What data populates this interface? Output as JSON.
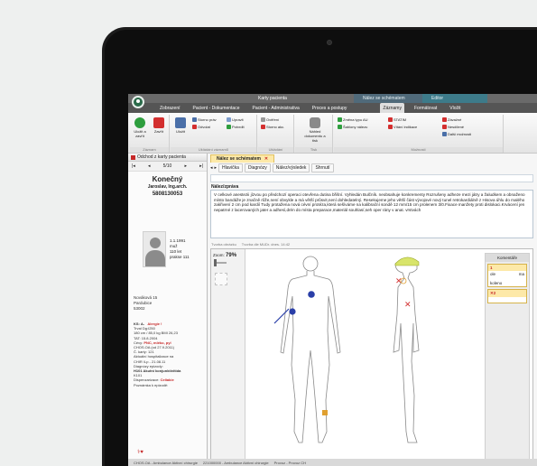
{
  "app": {
    "window_title": "Karty pacienta",
    "context_title_1": "Nález se schématem",
    "context_title_2": "Editor"
  },
  "tabs": [
    {
      "label": "Zobrazení"
    },
    {
      "label": "Pacient - Dokumentace"
    },
    {
      "label": "Pacient - Administrativa"
    },
    {
      "label": "Proces a postupy"
    },
    {
      "label": "Záznamy"
    },
    {
      "label": "Formátovat"
    },
    {
      "label": "Vložit"
    }
  ],
  "ribbon": {
    "btn_save": "Uložit a zavřít",
    "btn_close": "Zavřít",
    "btn_save2": "Uložit",
    "sm_1": "Storno práv",
    "sm_2": "Odvolat",
    "sm_3": "Upravit",
    "sm_4": "Potvrdit",
    "sm_5": "Ověření",
    "sm_6": "Storno akc.",
    "sm_print": "Náhled dokumentu a tisk",
    "sm_7": "Změna typu AU",
    "sm_8": "Šablony nálezu",
    "sm_9": "STATIM",
    "sm_10": "Vítání indikace",
    "sm_11": "Závažné",
    "sm_12": "Nesdílené",
    "sm_13": "Další možnosti",
    "g1": "Záznam",
    "g2": "Ukládání záznamů",
    "g3": "Ukládání",
    "g4": "Připomínky",
    "g5": "Tisk",
    "g6": "Možnosti"
  },
  "patient": {
    "close_card": "Odchod z karty pacienta",
    "nav": "5/10",
    "surname": "Konečný",
    "firstname": "Jaroslav, Ing.arch.",
    "id": "5808130053",
    "dob": "1.1.1991",
    "sex": "muž",
    "height": "110 let",
    "clinic": "prakse 111",
    "address_1": "Nováková 15",
    "address_2": "Pardubice",
    "address_3": "53002",
    "info_1": "KS: A-",
    "info_allergy": "Alergie !",
    "info_2": "Trval Dg:I250",
    "info_3": "180 cm / 85,0 kg BMI 26,23",
    "info_4": "TAT: 15.8.2004",
    "info_5_label": "Cévy:",
    "info_5_val": "PNC, mléko, pyl",
    "info_6": "CHOS.OA (od 27.9.2011)",
    "info_7": "Č. karty: 121",
    "info_8": "Aktuální hospitalizace na",
    "info_9": "CHIR /Lp - 21.08.11",
    "info_10": "Diagnózy epizody:",
    "info_11": "H101 Akutní konjunktivitida",
    "info_12": "K101",
    "info_13_label": "Dispenzarizace:",
    "info_13_val": "Celiakie",
    "info_14": "Poznámka k epizodě:"
  },
  "document": {
    "tab_title": "Nález se schématem",
    "toolbar": [
      "Hlavička",
      "Diagnózy",
      "Nález/výsledek",
      "Shrnutí"
    ],
    "section": "Nález/zpráva",
    "text": "V celkové anestezii jízvou po předchozí operaci otevřena dutina břišní. Vyhledán Bulčník. neobsahuje konkrementy Rozrušeny adheze mezi játry a žaludkem a obnaženo místo bandáže je značně růže,není obvykle a má větší průsvit,není dohledatelný. Resekujeme jeho větší část vývojové nový tunel retrokardiálně z Hisova úhlu do malého zakřivení 2 cm pod kardií Tudy protažena nová cévní protéza,která sešíváme na kalibrační sondě 12 mm/15 cm prolenem 3/0.Fixace manžety proti dislokaci.Krvácení jen nepatrné z lacerovaných jater a adhesí,drén do místa preparace,materiál souhlasí,seh oper rány v anat. vrstvách",
    "fig_bar_1": "Tvorba obrázku",
    "fig_bar_2": "Tvorba dle MUDr. dnes. 14:42",
    "zoom_label": "Zoom:",
    "zoom_value": "79%",
    "comments_header": "Komentáře",
    "comment1_num": "1",
    "comment1_text_1": "ole",
    "comment1_text_2": "ma",
    "comment1_text_3": "koleno",
    "comment2_num": "2"
  },
  "statusbar": {
    "s1": "CHOS.OA - Ambulance Aktivní chirurgie",
    "s2": "221000000 - Ambulance Aktivní chirurgie",
    "s3": "Provoz - Provoz CH"
  },
  "colors": {
    "marker_blue": "#2a3fa8",
    "marker_red": "#d32f2f",
    "marker_orange": "#e0a030"
  }
}
